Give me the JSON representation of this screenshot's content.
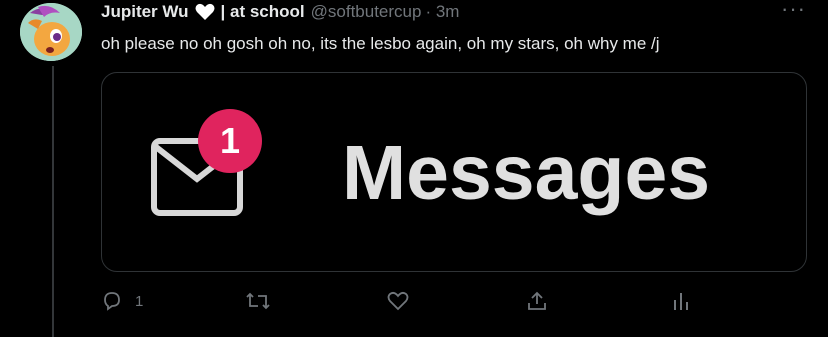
{
  "author": {
    "display_name": "Jupiter Wu",
    "name_suffix": "| at school",
    "handle": "@softbutercup",
    "timestamp": "· 3m"
  },
  "tweet": {
    "text": "oh please no oh gosh oh no, its the lesbo again, oh my stars, oh why me /j"
  },
  "media": {
    "badge_count": "1",
    "label": "Messages",
    "badge_color": "#e0245e"
  },
  "actions": {
    "reply_count": "1",
    "retweet_count": "",
    "like_count": ""
  },
  "colors": {
    "background": "#000000",
    "text": "#e7e9ea",
    "muted": "#71767b",
    "border": "#2f3336"
  },
  "icons": [
    "heart-icon",
    "more-icon",
    "mail-icon",
    "reply-icon",
    "retweet-icon",
    "like-icon",
    "share-icon",
    "analytics-icon"
  ]
}
